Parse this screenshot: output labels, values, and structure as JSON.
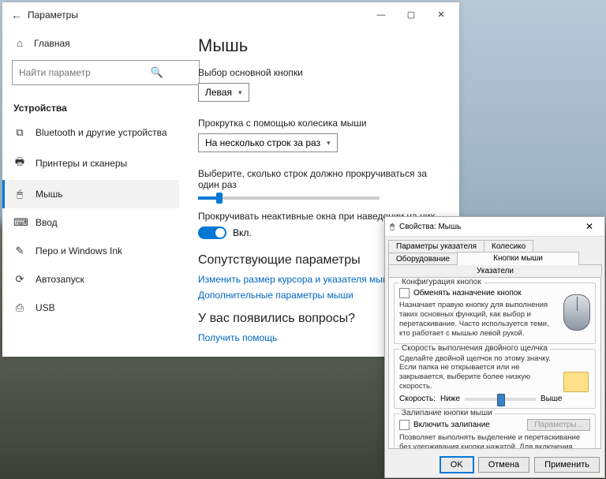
{
  "settings": {
    "titlebar": {
      "title": "Параметры"
    },
    "home_label": "Главная",
    "search_placeholder": "Найти параметр",
    "section_title": "Устройства",
    "nav": [
      {
        "icon": "⧉",
        "label": "Bluetooth и другие устройства"
      },
      {
        "icon": "🖶",
        "label": "Принтеры и сканеры"
      },
      {
        "icon": "🖱",
        "label": "Мышь"
      },
      {
        "icon": "⌨",
        "label": "Ввод"
      },
      {
        "icon": "✎",
        "label": "Перо и Windows Ink"
      },
      {
        "icon": "⟳",
        "label": "Автозапуск"
      },
      {
        "icon": "⎙",
        "label": "USB"
      }
    ],
    "content": {
      "page_title": "Мышь",
      "primary_button_label": "Выбор основной кнопки",
      "primary_button_value": "Левая",
      "scroll_wheel_label": "Прокрутка с помощью колесика мыши",
      "scroll_wheel_value": "На несколько строк за раз",
      "lines_label": "Выберите, сколько строк должно прокручиваться за один раз",
      "inactive_label": "Прокручивать неактивные окна при наведении на них",
      "toggle_on": "Вкл.",
      "related_heading": "Сопутствующие параметры",
      "link_cursor": "Изменить размер курсора и указателя мыши",
      "link_additional": "Дополнительные параметры мыши",
      "help_heading": "У вас появились вопросы?",
      "help_link": "Получить помощь"
    }
  },
  "classic": {
    "title": "Свойства: Мышь",
    "tabs": {
      "pointer_options": "Параметры указателя",
      "wheel": "Колесико",
      "hardware": "Оборудование",
      "buttons": "Кнопки мыши",
      "pointers": "Указатели"
    },
    "config_group": {
      "title": "Конфигурация кнопок",
      "swap_label": "Обменять назначение кнопок",
      "desc": "Назначает правую кнопку для выполнения таких основных функций, как выбор и перетаскивание. Часто используется теми, кто работает с мышью левой рукой."
    },
    "dblclick_group": {
      "title": "Скорость выполнения двойного щелчка",
      "desc": "Сделайте двойной щелчок по этому значку. Если папка не открывается или не закрывается, выберите более низкую скорость.",
      "speed_label": "Скорость:",
      "slow": "Ниже",
      "fast": "Выше"
    },
    "clicklock_group": {
      "title": "Залипание кнопки мыши",
      "enable_label": "Включить залипание",
      "params_btn": "Параметры...",
      "desc": "Позволяет выполнять выделение и перетаскивание без удерживания кнопки нажатой. Для включения ненадолго задержите кнопку мыши в нажатом положении. Для освобождения снова сделайте щелчок."
    },
    "buttons": {
      "ok": "OK",
      "cancel": "Отмена",
      "apply": "Применить"
    }
  }
}
